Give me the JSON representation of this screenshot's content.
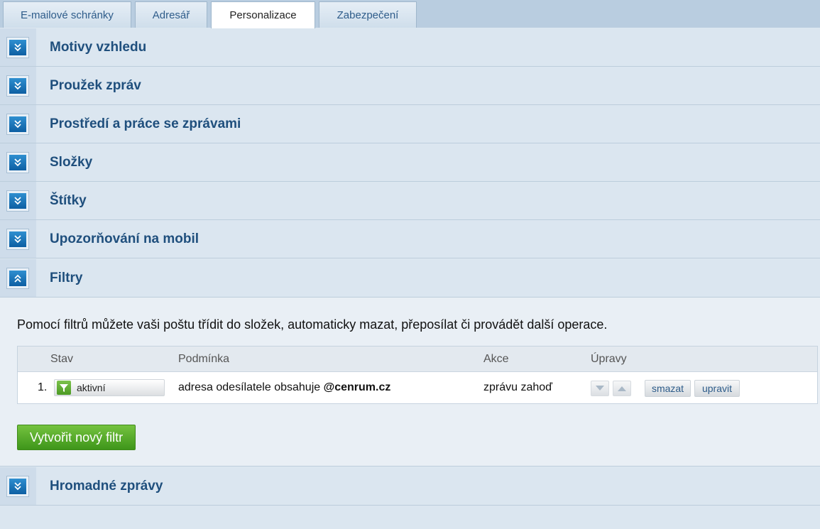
{
  "tabs": [
    {
      "label": "E-mailové schránky"
    },
    {
      "label": "Adresář"
    },
    {
      "label": "Personalizace",
      "active": true
    },
    {
      "label": "Zabezpečení"
    }
  ],
  "sections": [
    {
      "title": "Motivy vzhledu",
      "expanded": false
    },
    {
      "title": "Proužek zpráv",
      "expanded": false
    },
    {
      "title": "Prostředí a práce se zprávami",
      "expanded": false
    },
    {
      "title": "Složky",
      "expanded": false
    },
    {
      "title": "Štítky",
      "expanded": false
    },
    {
      "title": "Upozorňování na mobil",
      "expanded": false
    },
    {
      "title": "Filtry",
      "expanded": true
    },
    {
      "title": "Hromadné zprávy",
      "expanded": false
    }
  ],
  "filters": {
    "description": "Pomocí filtrů můžete vaši poštu třídit do složek, automaticky mazat, přeposílat či provádět další operace.",
    "columns": {
      "status": "Stav",
      "condition": "Podmínka",
      "action": "Akce",
      "edits": "Úpravy"
    },
    "rows": [
      {
        "number": "1.",
        "status": "aktivní",
        "condition_prefix": "adresa odesílatele obsahuje ",
        "condition_value": "@cenrum.cz",
        "action": "zprávu zahoď",
        "delete_label": "smazat",
        "edit_label": "upravit"
      }
    ],
    "create_label": "Vytvořit nový filtr"
  },
  "colors": {
    "accent_blue": "#1f4f7d",
    "button_green": "#4fa526",
    "icon_blue": "#1a74bb"
  }
}
